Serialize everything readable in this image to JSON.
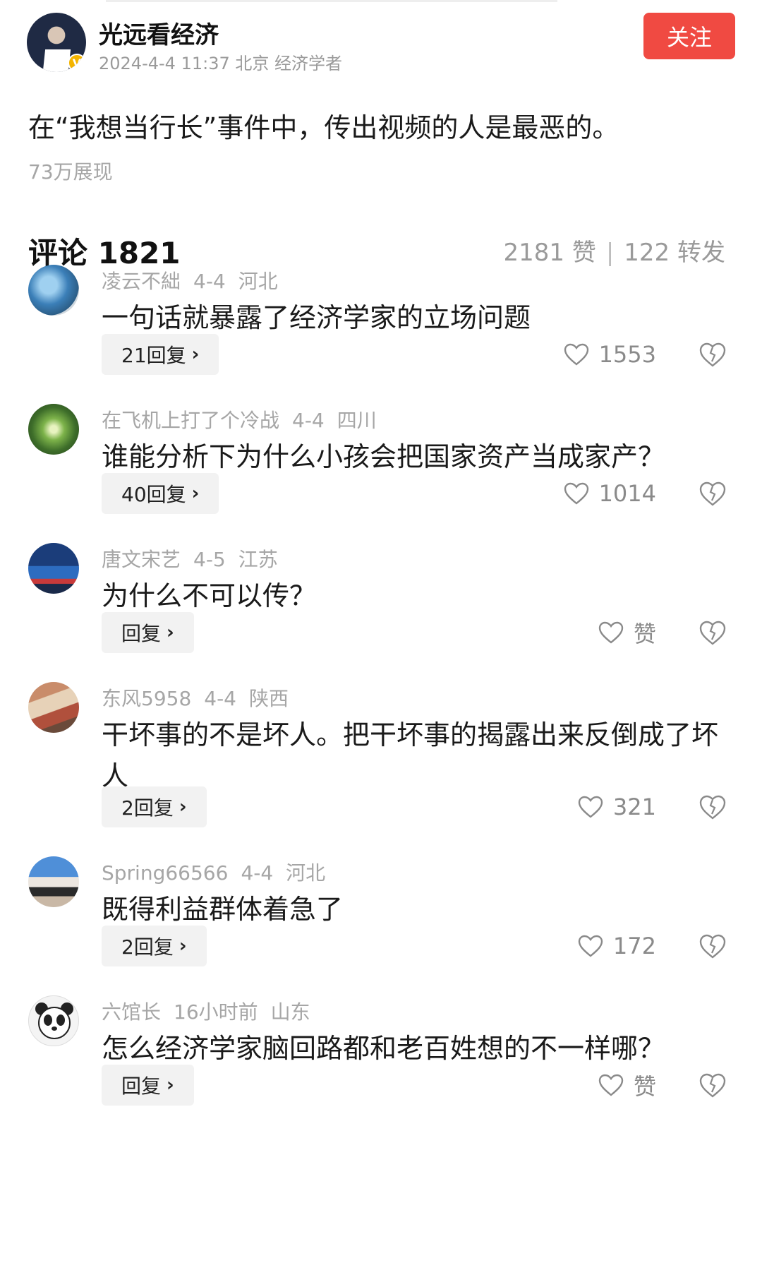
{
  "author": {
    "name": "光远看经济",
    "meta": "2024-4-4 11:37 北京 经济学者",
    "badge": "V",
    "follow_label": "关注"
  },
  "post": {
    "text": "在“我想当行长”事件中，传出视频的人是最恶的。",
    "views": "73万展现"
  },
  "comments_header": {
    "title": "评论 1821",
    "likes": "2181 赞",
    "separator": "|",
    "shares": "122 转发"
  },
  "comments": [
    {
      "name": "凌云不絀",
      "date": "4-4",
      "location": "河北",
      "text": "一句话就暴露了经济学家的立场问题",
      "reply": "21回复",
      "likes": "1553",
      "avatar": "globe-avatar"
    },
    {
      "name": "在飞机上打了个冷战",
      "date": "4-4",
      "location": "四川",
      "text": "谁能分析下为什么小孩会把国家资产当成家产？",
      "reply": "40回复",
      "likes": "1014",
      "avatar": "tree-avatar"
    },
    {
      "name": "唐文宋艺",
      "date": "4-5",
      "location": "江苏",
      "text": "为什么不可以传？",
      "reply": "回复",
      "likes": "赞",
      "avatar": "news-avatar"
    },
    {
      "name": "东风5958",
      "date": "4-4",
      "location": "陕西",
      "text": "干坏事的不是坏人。把干坏事的揭露出来反倒成了坏人",
      "reply": "2回复",
      "likes": "321",
      "avatar": "outdoor-avatar"
    },
    {
      "name": "Spring66566",
      "date": "4-4",
      "location": "河北",
      "text": "既得利益群体着急了",
      "reply": "2回复",
      "likes": "172",
      "avatar": "portrait-avatar"
    },
    {
      "name": "六馆长",
      "date": "16小时前",
      "location": "山东",
      "text": "怎么经济学家脑回路都和老百姓想的不一样哪？",
      "reply": "回复",
      "likes": "赞",
      "avatar": "panda-avatar"
    }
  ],
  "colors": {
    "follow_bg": "#f04a42",
    "meta_gray": "#a6a6a6",
    "pill_bg": "#f2f2f2"
  }
}
